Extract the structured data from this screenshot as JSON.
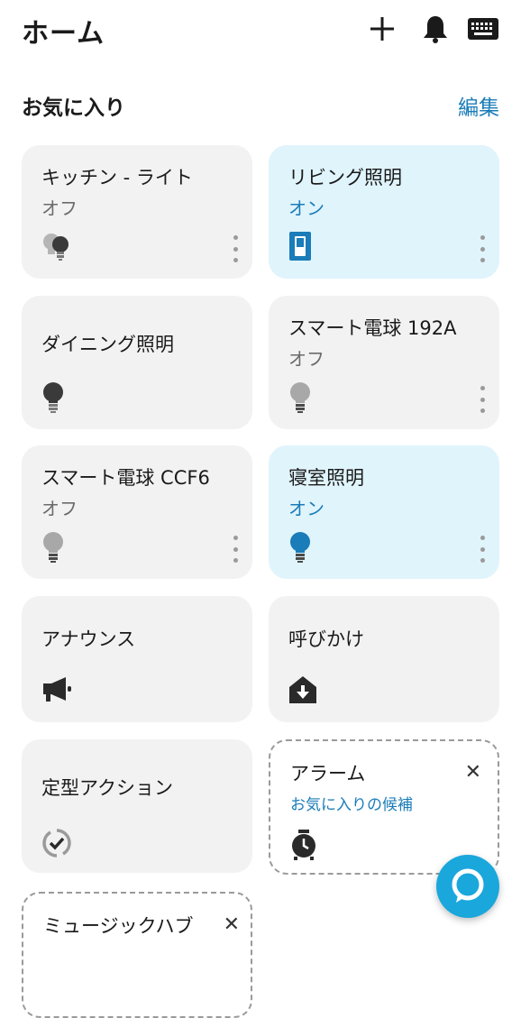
{
  "header": {
    "title": "ホーム"
  },
  "favorites": {
    "title": "お気に入り",
    "edit_label": "編集"
  },
  "cards": [
    {
      "name": "キッチン - ライト",
      "status": "オフ"
    },
    {
      "name": "リビング照明",
      "status": "オン"
    },
    {
      "name": "ダイニング照明"
    },
    {
      "name": "スマート電球 192A",
      "status": "オフ"
    },
    {
      "name": "スマート電球 CCF6",
      "status": "オフ"
    },
    {
      "name": "寝室照明",
      "status": "オン"
    },
    {
      "name": "アナウンス"
    },
    {
      "name": "呼びかけ"
    },
    {
      "name": "定型アクション"
    },
    {
      "name": "アラーム",
      "subtitle": "お気に入りの候補"
    },
    {
      "name": "ミュージックハブ"
    }
  ],
  "colors": {
    "accent": "#1a7cb8",
    "fab": "#1aa7dc",
    "on_card": "#e0f4fc",
    "off_card": "#f2f2f2"
  }
}
